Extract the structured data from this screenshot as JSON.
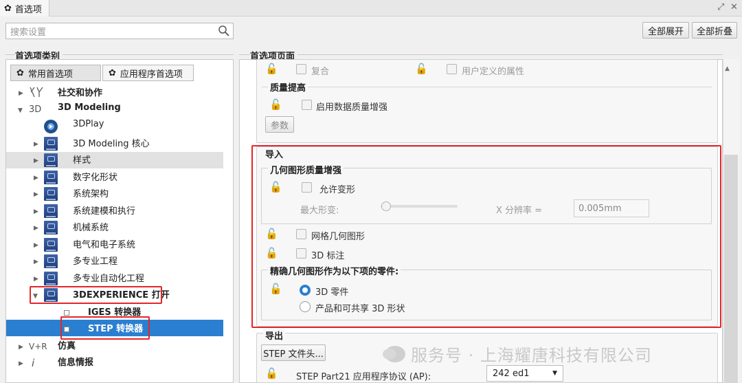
{
  "titlebar": {
    "title": "首选项",
    "expand_icon": "⤢",
    "close_icon": "✕"
  },
  "search": {
    "placeholder": "搜索设置"
  },
  "top_buttons": {
    "expand_all": "全部展开",
    "collapse_all": "全部折叠"
  },
  "left": {
    "section_title": "首选项类别",
    "tabs": [
      "常用首选项",
      "应用程序首选项"
    ],
    "tree": [
      {
        "label": "社交和协作",
        "bold": true,
        "prefix": ""
      },
      {
        "label": "3D Modeling",
        "bold": true,
        "prefix": "3D"
      },
      {
        "label": "3DPlay"
      },
      {
        "label": "3D Modeling 核心"
      },
      {
        "label": "样式"
      },
      {
        "label": "数字化形状"
      },
      {
        "label": "系统架构"
      },
      {
        "label": "系统建模和执行"
      },
      {
        "label": "机械系统"
      },
      {
        "label": "电气和电子系统"
      },
      {
        "label": "多专业工程"
      },
      {
        "label": "多专业自动化工程"
      },
      {
        "label": "3DEXPERIENCE 打开"
      },
      {
        "label": "IGES 转换器"
      },
      {
        "label": "STEP 转换器"
      },
      {
        "label": "仿真",
        "bold": true,
        "prefix": "V+R"
      },
      {
        "label": "信息情报",
        "bold": true,
        "prefix": "i"
      }
    ]
  },
  "right": {
    "section_title": "首选项页面",
    "top_options": [
      "复合",
      "用户定义的属性"
    ],
    "quality": {
      "title": "质量提高",
      "option": "启用数据质量增强",
      "button": "参数"
    },
    "import": {
      "title": "导入",
      "geom_group": "几何图形质量增强",
      "allow_deform": "允许变形",
      "max_deform": "最大形变:",
      "x_res": "X 分辨率 =",
      "x_res_value": "0.005mm",
      "mesh_geom": "网格几何图形",
      "annot_3d": "3D 标注",
      "precise_group": "精确几何图形作为以下项的零件:",
      "radio_part": "3D 零件",
      "radio_product": "产品和可共享 3D 形状"
    },
    "export": {
      "title": "导出",
      "header_button": "STEP 文件头...",
      "ap_label": "STEP Part21 应用程序协议 (AP):",
      "ap_value": "242 ed1"
    }
  },
  "watermark": "服务号 · 上海耀唐科技有限公司",
  "colors": {
    "highlight": "#2b7fd0",
    "annotation": "#e2262b"
  }
}
